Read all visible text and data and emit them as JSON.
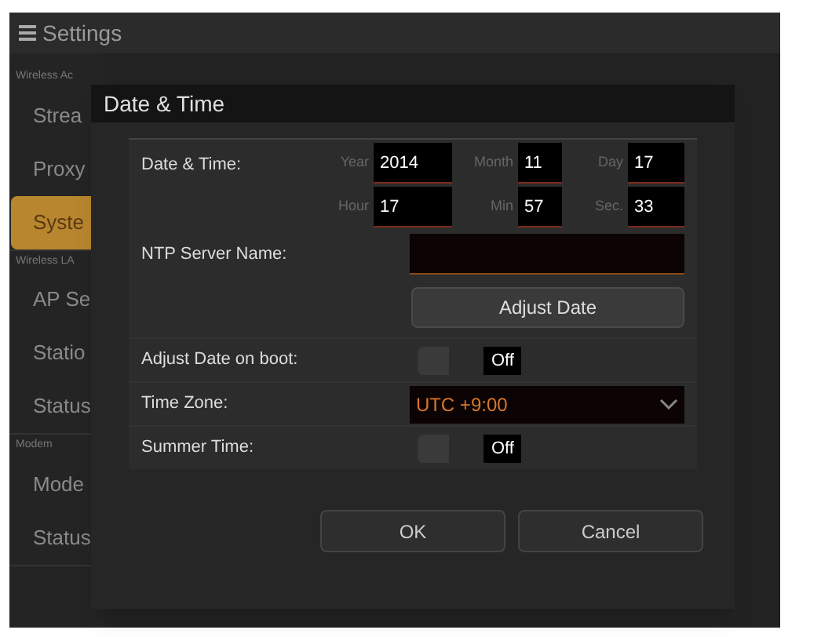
{
  "header": {
    "title": "Settings"
  },
  "sidebar": {
    "sections": [
      {
        "heading": "Wireless Ac",
        "items": [
          {
            "label": "Strea",
            "selected": false
          },
          {
            "label": "Proxy",
            "selected": false
          },
          {
            "label": "Syste",
            "selected": true
          }
        ]
      },
      {
        "heading": "Wireless LA",
        "items": [
          {
            "label": "AP Se",
            "selected": false
          },
          {
            "label": "Statio",
            "selected": false
          },
          {
            "label": "Status",
            "selected": false
          }
        ]
      },
      {
        "heading": "Modem",
        "items": [
          {
            "label": "Mode",
            "selected": false
          },
          {
            "label": "Status",
            "selected": false
          }
        ]
      }
    ]
  },
  "dialog": {
    "title": "Date & Time",
    "date_time": {
      "label": "Date & Time:",
      "rows": [
        [
          {
            "label": "Year",
            "value": "2014"
          },
          {
            "label": "Month",
            "value": "11"
          },
          {
            "label": "Day",
            "value": "17"
          }
        ],
        [
          {
            "label": "Hour",
            "value": "17"
          },
          {
            "label": "Min",
            "value": "57"
          },
          {
            "label": "Sec.",
            "value": "33"
          }
        ]
      ]
    },
    "ntp": {
      "label": "NTP Server Name:"
    },
    "adjust_button": "Adjust Date",
    "adjust_on_boot": {
      "label": "Adjust Date on boot:",
      "on": false,
      "state_text": "Off"
    },
    "time_zone": {
      "label": "Time Zone:",
      "value": "UTC +9:00"
    },
    "summer_time": {
      "label": "Summer Time:",
      "on": false,
      "state_text": "Off"
    },
    "buttons": [
      "OK",
      "Cancel"
    ]
  }
}
